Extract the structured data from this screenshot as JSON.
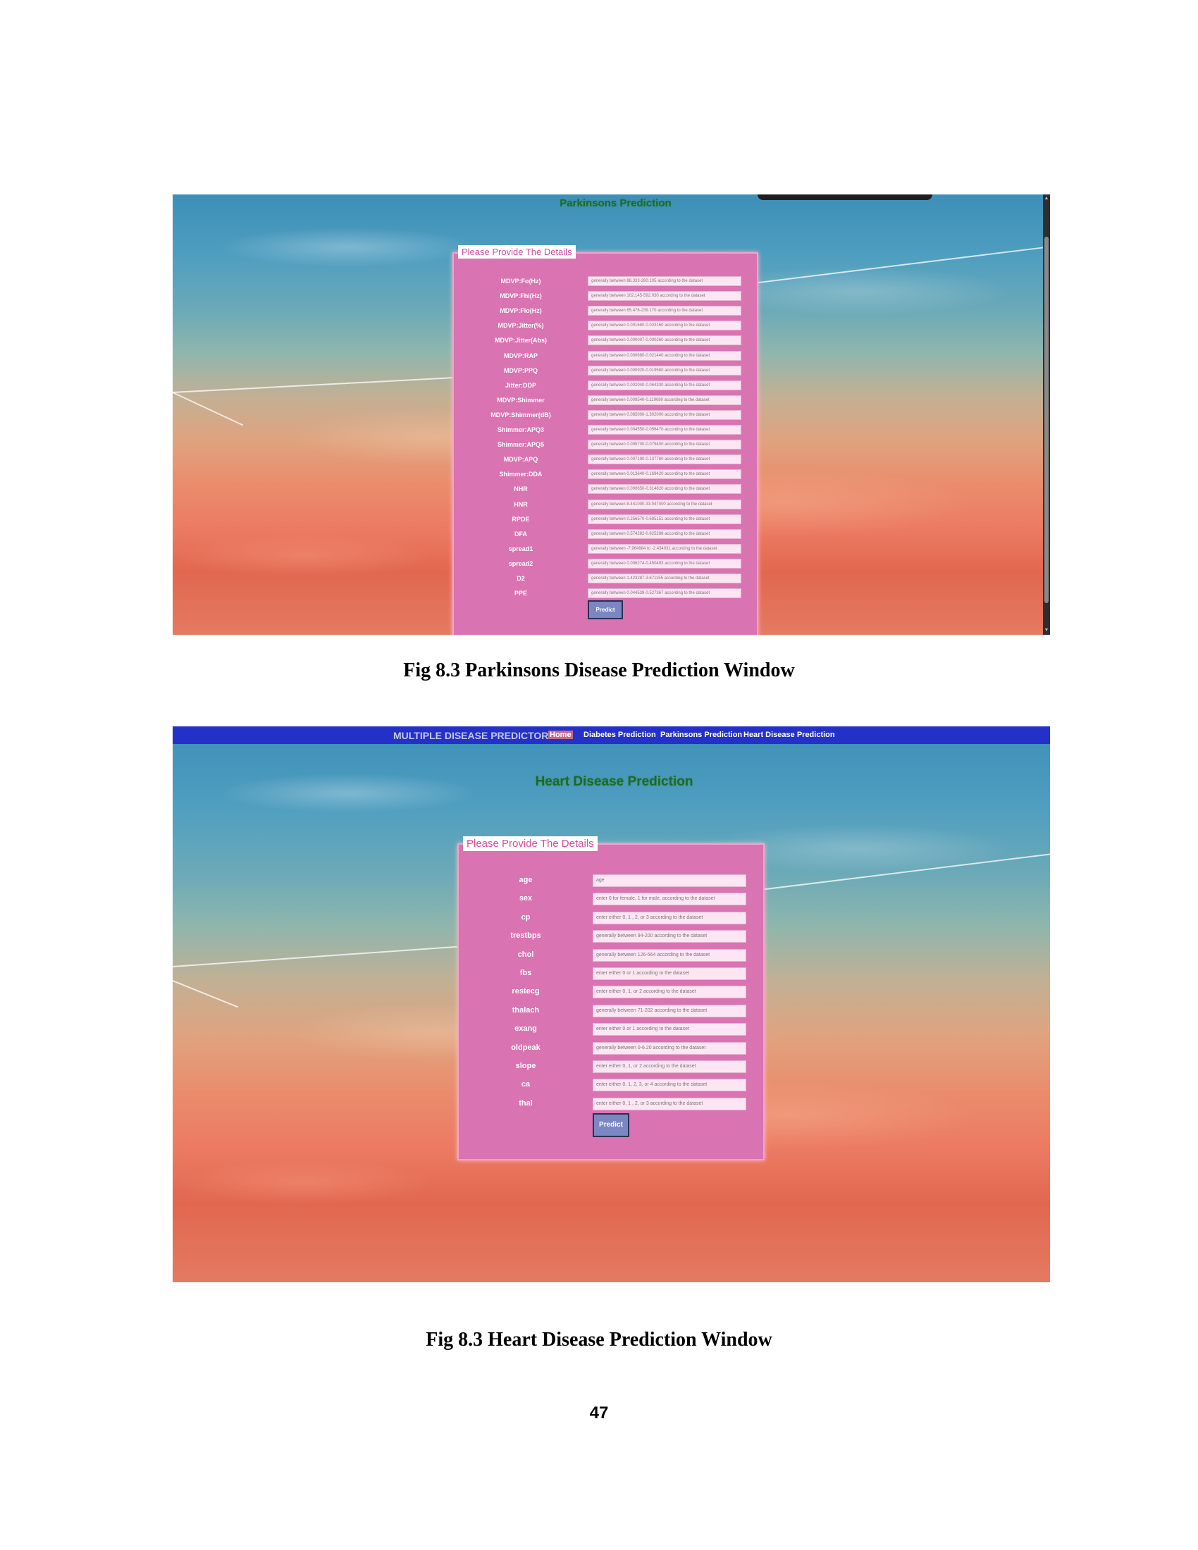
{
  "figure1": {
    "page_title": "Parkinsons Prediction",
    "legend": "Please Provide The Details",
    "fields": [
      {
        "label": "MDVP:Fo(Hz)",
        "placeholder": "generally between 88.333-260.105 according to the dataset"
      },
      {
        "label": "MDVP:Fhi(Hz)",
        "placeholder": "generally between 102.145-592.030 according to the dataset"
      },
      {
        "label": "MDVP:Flo(Hz)",
        "placeholder": "generally between 65.476-239.170 according to the dataset"
      },
      {
        "label": "MDVP:Jitter(%)",
        "placeholder": "generally between 0.001680-0.033160 according to the dataset"
      },
      {
        "label": "MDVP:Jitter(Abs)",
        "placeholder": "generally between 0.000007-0.000260 according to the dataset"
      },
      {
        "label": "MDVP:RAP",
        "placeholder": "generally between 0.000680-0.021440 according to the dataset"
      },
      {
        "label": "MDVP:PPQ",
        "placeholder": "generally between 0.000920-0.019580 according to the dataset"
      },
      {
        "label": "Jitter:DDP",
        "placeholder": "generally between 0.002040-0.064330 according to the dataset"
      },
      {
        "label": "MDVP:Shimmer",
        "placeholder": "generally between 0.009540-0.119080 according to the dataset"
      },
      {
        "label": "MDVP:Shimmer(dB)",
        "placeholder": "generally between 0.085000-1.302000 according to the dataset"
      },
      {
        "label": "Shimmer:APQ3",
        "placeholder": "generally between 0.004550-0.056470 according to the dataset"
      },
      {
        "label": "Shimmer:APQ5",
        "placeholder": "generally between 0.005700-0.079400 according to the dataset"
      },
      {
        "label": "MDVP:APQ",
        "placeholder": "generally between 0.007190-0.137780 according to the dataset"
      },
      {
        "label": "Shimmer:DDA",
        "placeholder": "generally between 0.013640-0.169420 according to the dataset"
      },
      {
        "label": "NHR",
        "placeholder": "generally between 0.000650-0.314820 according to the dataset"
      },
      {
        "label": "HNR",
        "placeholder": "generally between 8.441000-33.047000 according to the dataset"
      },
      {
        "label": "RPDE",
        "placeholder": "generally between 0.256570-0.685151 according to the dataset"
      },
      {
        "label": "DFA",
        "placeholder": "generally between 0.574282-0.825288 according to the dataset"
      },
      {
        "label": "spread1",
        "placeholder": "generally between -7.964984 to -2.434031 according to the dataset"
      },
      {
        "label": "spread2",
        "placeholder": "generally between 0.006274-0.450493 according to the dataset"
      },
      {
        "label": "D2",
        "placeholder": "generally between 1.423287-3.671155 according to the dataset"
      },
      {
        "label": "PPE",
        "placeholder": "generally between 0.044539-0.527367 according to the dataset"
      }
    ],
    "predict_label": "Predict",
    "caption": "Fig 8.3 Parkinsons Disease Prediction Window"
  },
  "figure2": {
    "nav": {
      "brand": "MULTIPLE DISEASE PREDICTOR",
      "home": "Home",
      "diabetes": "Diabetes Prediction",
      "parkinsons": "Parkinsons Prediction",
      "heart": "Heart Disease Prediction"
    },
    "page_title": "Heart Disease Prediction",
    "legend": "Please Provide The Details",
    "fields": [
      {
        "label": "age",
        "placeholder": "age"
      },
      {
        "label": "sex",
        "placeholder": "enter 0 for female, 1 for male, according to the dataset"
      },
      {
        "label": "cp",
        "placeholder": "enter either 0, 1 , 2, or 3 according to the dataset"
      },
      {
        "label": "trestbps",
        "placeholder": "generally between 94-200 according to the dataset"
      },
      {
        "label": "chol",
        "placeholder": "generally between 126-564 according to the dataset"
      },
      {
        "label": "fbs",
        "placeholder": "enter either 0 or 1 according to the dataset"
      },
      {
        "label": "restecg",
        "placeholder": "enter either 0, 1, or 2 according to the dataset"
      },
      {
        "label": "thalach",
        "placeholder": "generally between 71-202 according to the dataset"
      },
      {
        "label": "exang",
        "placeholder": "enter either 0 or 1 according to the dataset"
      },
      {
        "label": "oldpeak",
        "placeholder": "generally between 0-6.20 according to the dataset"
      },
      {
        "label": "slope",
        "placeholder": "enter either 0, 1, or 2 according to the dataset"
      },
      {
        "label": "ca",
        "placeholder": "enter either 0, 1, 2, 3, or 4 according to the dataset"
      },
      {
        "label": "thal",
        "placeholder": "enter either 0, 1 , 2, or 3 according to the dataset"
      }
    ],
    "predict_label": "Predict",
    "caption": "Fig 8.3 Heart Disease Prediction Window"
  },
  "page_number": "47",
  "colors": {
    "panel": "#d973b2",
    "legend_text": "#d64b9d",
    "title_green": "#1d6b1d",
    "navbar": "#2431c9",
    "button": "#7a87c2"
  }
}
